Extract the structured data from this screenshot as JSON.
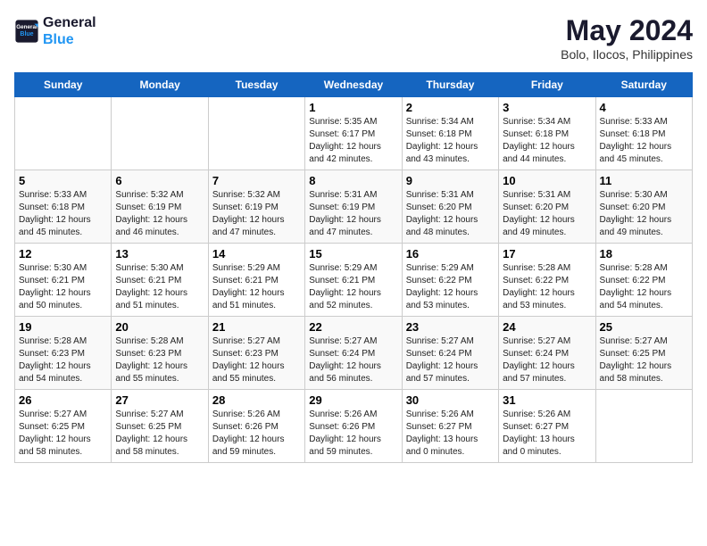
{
  "logo": {
    "line1": "General",
    "line2": "Blue"
  },
  "title": "May 2024",
  "subtitle": "Bolo, Ilocos, Philippines",
  "weekdays": [
    "Sunday",
    "Monday",
    "Tuesday",
    "Wednesday",
    "Thursday",
    "Friday",
    "Saturday"
  ],
  "weeks": [
    [
      {
        "day": "",
        "sunrise": "",
        "sunset": "",
        "daylight": ""
      },
      {
        "day": "",
        "sunrise": "",
        "sunset": "",
        "daylight": ""
      },
      {
        "day": "",
        "sunrise": "",
        "sunset": "",
        "daylight": ""
      },
      {
        "day": "1",
        "sunrise": "Sunrise: 5:35 AM",
        "sunset": "Sunset: 6:17 PM",
        "daylight": "Daylight: 12 hours and 42 minutes."
      },
      {
        "day": "2",
        "sunrise": "Sunrise: 5:34 AM",
        "sunset": "Sunset: 6:18 PM",
        "daylight": "Daylight: 12 hours and 43 minutes."
      },
      {
        "day": "3",
        "sunrise": "Sunrise: 5:34 AM",
        "sunset": "Sunset: 6:18 PM",
        "daylight": "Daylight: 12 hours and 44 minutes."
      },
      {
        "day": "4",
        "sunrise": "Sunrise: 5:33 AM",
        "sunset": "Sunset: 6:18 PM",
        "daylight": "Daylight: 12 hours and 45 minutes."
      }
    ],
    [
      {
        "day": "5",
        "sunrise": "Sunrise: 5:33 AM",
        "sunset": "Sunset: 6:18 PM",
        "daylight": "Daylight: 12 hours and 45 minutes."
      },
      {
        "day": "6",
        "sunrise": "Sunrise: 5:32 AM",
        "sunset": "Sunset: 6:19 PM",
        "daylight": "Daylight: 12 hours and 46 minutes."
      },
      {
        "day": "7",
        "sunrise": "Sunrise: 5:32 AM",
        "sunset": "Sunset: 6:19 PM",
        "daylight": "Daylight: 12 hours and 47 minutes."
      },
      {
        "day": "8",
        "sunrise": "Sunrise: 5:31 AM",
        "sunset": "Sunset: 6:19 PM",
        "daylight": "Daylight: 12 hours and 47 minutes."
      },
      {
        "day": "9",
        "sunrise": "Sunrise: 5:31 AM",
        "sunset": "Sunset: 6:20 PM",
        "daylight": "Daylight: 12 hours and 48 minutes."
      },
      {
        "day": "10",
        "sunrise": "Sunrise: 5:31 AM",
        "sunset": "Sunset: 6:20 PM",
        "daylight": "Daylight: 12 hours and 49 minutes."
      },
      {
        "day": "11",
        "sunrise": "Sunrise: 5:30 AM",
        "sunset": "Sunset: 6:20 PM",
        "daylight": "Daylight: 12 hours and 49 minutes."
      }
    ],
    [
      {
        "day": "12",
        "sunrise": "Sunrise: 5:30 AM",
        "sunset": "Sunset: 6:21 PM",
        "daylight": "Daylight: 12 hours and 50 minutes."
      },
      {
        "day": "13",
        "sunrise": "Sunrise: 5:30 AM",
        "sunset": "Sunset: 6:21 PM",
        "daylight": "Daylight: 12 hours and 51 minutes."
      },
      {
        "day": "14",
        "sunrise": "Sunrise: 5:29 AM",
        "sunset": "Sunset: 6:21 PM",
        "daylight": "Daylight: 12 hours and 51 minutes."
      },
      {
        "day": "15",
        "sunrise": "Sunrise: 5:29 AM",
        "sunset": "Sunset: 6:21 PM",
        "daylight": "Daylight: 12 hours and 52 minutes."
      },
      {
        "day": "16",
        "sunrise": "Sunrise: 5:29 AM",
        "sunset": "Sunset: 6:22 PM",
        "daylight": "Daylight: 12 hours and 53 minutes."
      },
      {
        "day": "17",
        "sunrise": "Sunrise: 5:28 AM",
        "sunset": "Sunset: 6:22 PM",
        "daylight": "Daylight: 12 hours and 53 minutes."
      },
      {
        "day": "18",
        "sunrise": "Sunrise: 5:28 AM",
        "sunset": "Sunset: 6:22 PM",
        "daylight": "Daylight: 12 hours and 54 minutes."
      }
    ],
    [
      {
        "day": "19",
        "sunrise": "Sunrise: 5:28 AM",
        "sunset": "Sunset: 6:23 PM",
        "daylight": "Daylight: 12 hours and 54 minutes."
      },
      {
        "day": "20",
        "sunrise": "Sunrise: 5:28 AM",
        "sunset": "Sunset: 6:23 PM",
        "daylight": "Daylight: 12 hours and 55 minutes."
      },
      {
        "day": "21",
        "sunrise": "Sunrise: 5:27 AM",
        "sunset": "Sunset: 6:23 PM",
        "daylight": "Daylight: 12 hours and 55 minutes."
      },
      {
        "day": "22",
        "sunrise": "Sunrise: 5:27 AM",
        "sunset": "Sunset: 6:24 PM",
        "daylight": "Daylight: 12 hours and 56 minutes."
      },
      {
        "day": "23",
        "sunrise": "Sunrise: 5:27 AM",
        "sunset": "Sunset: 6:24 PM",
        "daylight": "Daylight: 12 hours and 57 minutes."
      },
      {
        "day": "24",
        "sunrise": "Sunrise: 5:27 AM",
        "sunset": "Sunset: 6:24 PM",
        "daylight": "Daylight: 12 hours and 57 minutes."
      },
      {
        "day": "25",
        "sunrise": "Sunrise: 5:27 AM",
        "sunset": "Sunset: 6:25 PM",
        "daylight": "Daylight: 12 hours and 58 minutes."
      }
    ],
    [
      {
        "day": "26",
        "sunrise": "Sunrise: 5:27 AM",
        "sunset": "Sunset: 6:25 PM",
        "daylight": "Daylight: 12 hours and 58 minutes."
      },
      {
        "day": "27",
        "sunrise": "Sunrise: 5:27 AM",
        "sunset": "Sunset: 6:25 PM",
        "daylight": "Daylight: 12 hours and 58 minutes."
      },
      {
        "day": "28",
        "sunrise": "Sunrise: 5:26 AM",
        "sunset": "Sunset: 6:26 PM",
        "daylight": "Daylight: 12 hours and 59 minutes."
      },
      {
        "day": "29",
        "sunrise": "Sunrise: 5:26 AM",
        "sunset": "Sunset: 6:26 PM",
        "daylight": "Daylight: 12 hours and 59 minutes."
      },
      {
        "day": "30",
        "sunrise": "Sunrise: 5:26 AM",
        "sunset": "Sunset: 6:27 PM",
        "daylight": "Daylight: 13 hours and 0 minutes."
      },
      {
        "day": "31",
        "sunrise": "Sunrise: 5:26 AM",
        "sunset": "Sunset: 6:27 PM",
        "daylight": "Daylight: 13 hours and 0 minutes."
      },
      {
        "day": "",
        "sunrise": "",
        "sunset": "",
        "daylight": ""
      }
    ]
  ]
}
